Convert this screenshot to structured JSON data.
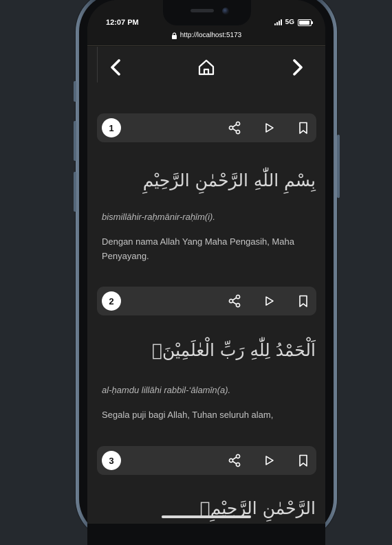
{
  "status_bar": {
    "time": "12:07 PM",
    "network": "5G"
  },
  "browser": {
    "url": "http://localhost:5173"
  },
  "navigation": {
    "prev_icon": "chevron-left-icon",
    "home_icon": "home-icon",
    "next_icon": "chevron-right-icon"
  },
  "ayahs": [
    {
      "number": "1",
      "arabic": "بِسْمِ اللّٰهِ الرَّحْمٰنِ الرَّحِيْمِ",
      "latin": "bismillāhir-raḥmānir-raḥīm(i).",
      "translation": "Dengan nama Allah Yang Maha Pengasih, Maha Penyayang."
    },
    {
      "number": "2",
      "arabic": "اَلْحَمْدُ لِلّٰهِ رَبِّ الْعٰلَمِيْنَۙ",
      "latin": "al-ḥamdu lillāhi rabbil-‘ālamīn(a).",
      "translation": "Segala puji bagi Allah, Tuhan seluruh alam,"
    },
    {
      "number": "3",
      "arabic": "الرَّحْمٰنِ الرَّحِيْمِۙ",
      "latin": "",
      "translation": ""
    }
  ],
  "icons": {
    "share": "share-icon",
    "play": "play-icon",
    "bookmark": "bookmark-icon",
    "lock": "lock-icon"
  },
  "colors": {
    "background": "#202020",
    "bar": "#323232",
    "badge": "#ffffff"
  }
}
